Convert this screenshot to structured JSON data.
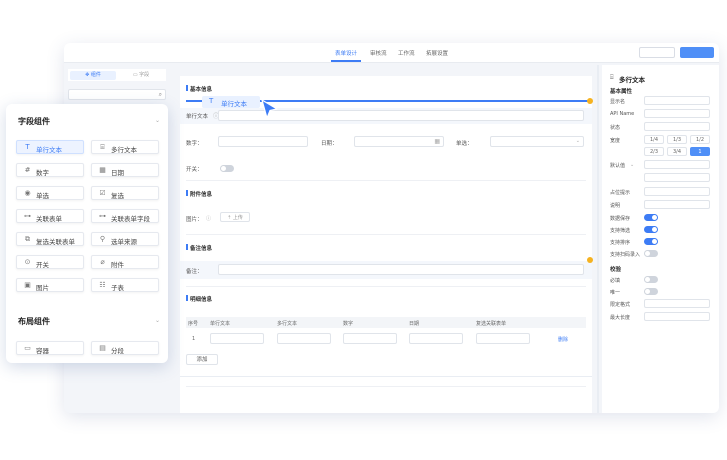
{
  "topbar": {
    "tabs": [
      "表单设计",
      "审核流",
      "工作流",
      "拓展设置"
    ],
    "active_tab": "表单设计"
  },
  "left_panel": {
    "segments": [
      "组件",
      "字段"
    ]
  },
  "canvas": {
    "section_basic": "基本信息",
    "drag_ghost_label": "单行文本",
    "field_single_text": "单行文本",
    "field_number": "数字：",
    "field_date": "日期：",
    "field_single_choice": "单选：",
    "field_switch": "开关：",
    "section_attachment": "附件信息",
    "field_image": "图片：",
    "upload_button": "上传",
    "section_remark": "备注信息",
    "field_remark": "备注：",
    "section_detail": "明细信息",
    "table_headers": [
      "序号",
      "单行文本",
      "多行文本",
      "数字",
      "日期",
      "复选关联表单"
    ],
    "row_index": "1",
    "row_delete": "删除",
    "add_button": "添加"
  },
  "right_panel": {
    "title": "多行文本",
    "section_basic": "基本属性",
    "labels": [
      "显示名",
      "API Name",
      "状态",
      "宽度",
      "默认值",
      "占位提示",
      "说明",
      "数据保存",
      "支持筛选",
      "支持排序",
      "支持扫码录入"
    ],
    "width_options": [
      "1/4",
      "1/3",
      "1/2",
      "2/3",
      "3/4",
      "1"
    ],
    "width_selected": "1",
    "section_validation": "校验",
    "validation_labels": [
      "必填",
      "唯一",
      "限定格式",
      "最大长度"
    ]
  },
  "palette": {
    "field_group_title": "字段组件",
    "field_items": [
      "单行文本",
      "多行文本",
      "数字",
      "日期",
      "单选",
      "复选",
      "关联表单",
      "关联表单字段",
      "复选关联表单",
      "选单来源",
      "开关",
      "附件",
      "图片",
      "子表"
    ],
    "selected_item": "单行文本",
    "layout_group_title": "布局组件",
    "layout_items": [
      "容器",
      "分段"
    ]
  },
  "colors": {
    "accent": "#3d7cf5",
    "button_primary": "#4f8ff7",
    "warning_dot": "#f5b220"
  },
  "icons": {
    "cursor": "arrow-cursor-icon",
    "search": "search-icon",
    "chevron": "chevron-down-icon"
  }
}
